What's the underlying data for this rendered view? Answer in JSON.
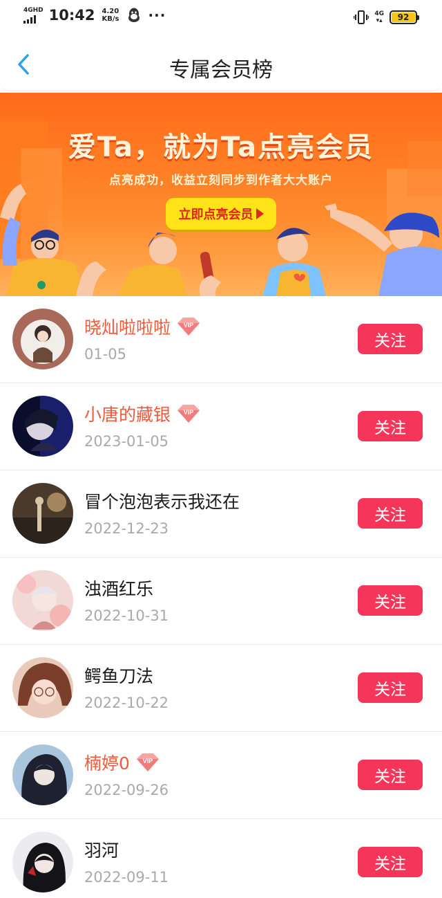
{
  "status_bar": {
    "network_label": "4GHD",
    "time": "10:42",
    "speed_value": "4.20",
    "speed_unit": "KB/s",
    "more": "···",
    "net_type": "4G",
    "battery": "92",
    "battery_color": "#f5c518"
  },
  "nav": {
    "title": "专属会员榜",
    "back_icon": "chevron-left-icon",
    "accent": "#2aa0ee"
  },
  "banner": {
    "title": "爱Ta，就为Ta点亮会员",
    "subtitle": "点亮成功，收益立刻同步到作者大大账户",
    "button_label": "立即点亮会员"
  },
  "follow_label": "关注",
  "members": [
    {
      "name": "晓灿啦啦啦",
      "date": "01-05",
      "vip": true
    },
    {
      "name": "小唐的藏银",
      "date": "2023-01-05",
      "vip": true
    },
    {
      "name": "冒个泡泡表示我还在",
      "date": "2022-12-23",
      "vip": false
    },
    {
      "name": "浊酒红乐",
      "date": "2022-10-31",
      "vip": false
    },
    {
      "name": "鳄鱼刀法",
      "date": "2022-10-22",
      "vip": false
    },
    {
      "name": "楠婷0",
      "date": "2022-09-26",
      "vip": true
    },
    {
      "name": "羽河",
      "date": "2022-09-11",
      "vip": false
    }
  ],
  "colors": {
    "vip_name": "#ef5a3d",
    "follow_button": "#f6355b",
    "banner": "#ff7a22"
  }
}
